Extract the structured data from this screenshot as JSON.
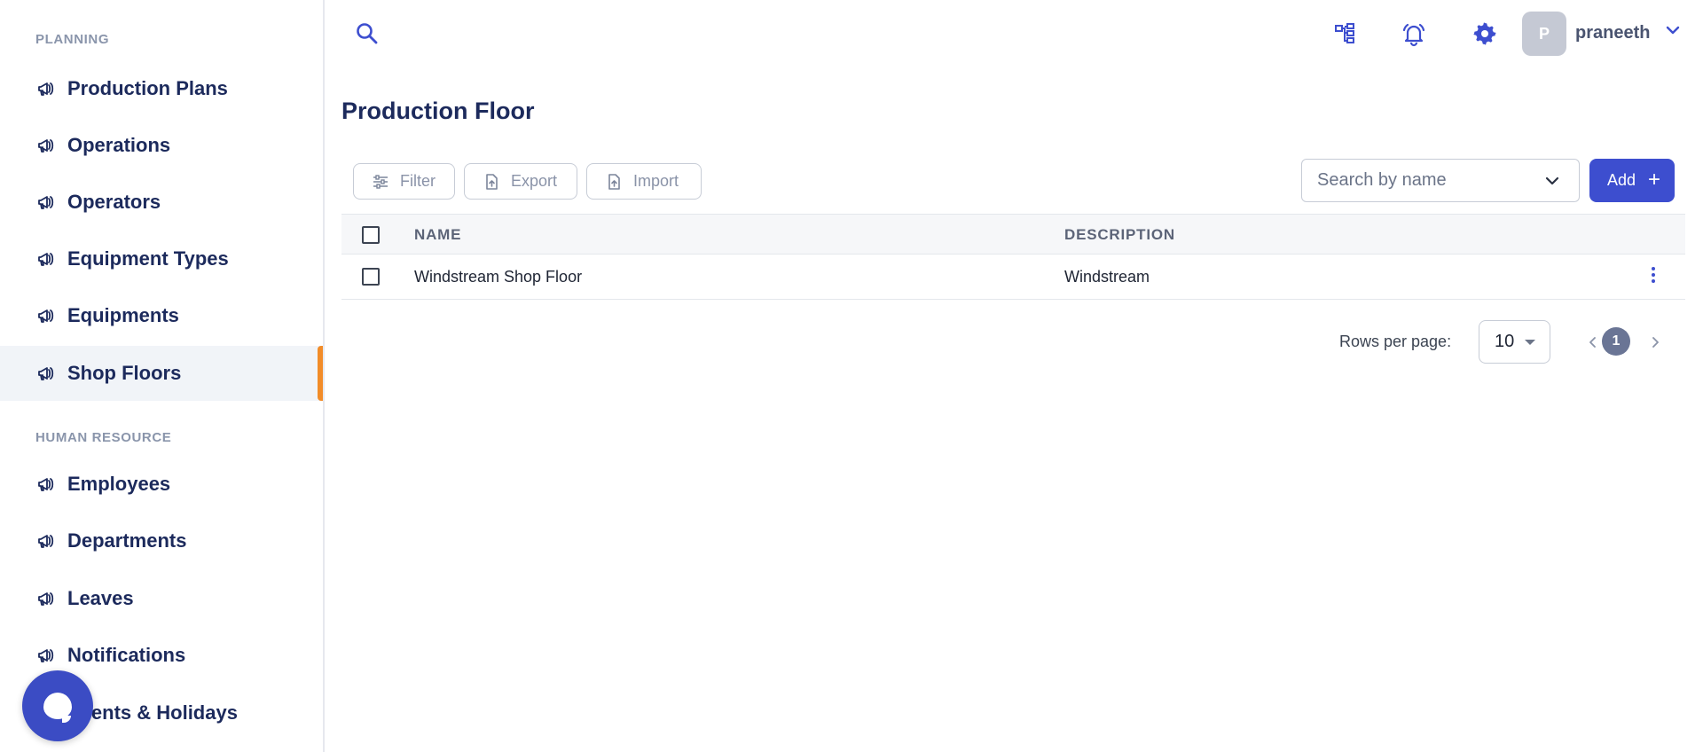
{
  "sidebar": {
    "planning_title": "PLANNING",
    "planning_items": [
      {
        "label": "Production Plans"
      },
      {
        "label": "Operations"
      },
      {
        "label": "Operators"
      },
      {
        "label": "Equipment Types"
      },
      {
        "label": "Equipments"
      },
      {
        "label": "Shop Floors",
        "active": true
      }
    ],
    "hr_title": "HUMAN RESOURCE",
    "hr_items": [
      {
        "label": "Employees"
      },
      {
        "label": "Departments"
      },
      {
        "label": "Leaves"
      },
      {
        "label": "Notifications"
      },
      {
        "label": "Events & Holidays"
      }
    ],
    "nav_icon": "megaphone-icon",
    "active_accent": "#f28c28"
  },
  "topbar": {
    "icons": [
      "search-icon",
      "hierarchy-icon",
      "bell-icon",
      "gear-icon",
      "chevron-down-icon"
    ],
    "avatar_initial": "P",
    "username": "praneeth"
  },
  "page": {
    "title": "Production Floor"
  },
  "toolbar": {
    "filter_label": "Filter",
    "export_label": "Export",
    "import_label": "Import",
    "search_placeholder": "Search by name",
    "add_label": "Add",
    "add_symbol": "+"
  },
  "table": {
    "columns": [
      "NAME",
      "DESCRIPTION"
    ],
    "rows": [
      {
        "name": "Windstream Shop Floor",
        "description": "Windstream"
      }
    ]
  },
  "pagination": {
    "rows_per_page_label": "Rows per page:",
    "rows_per_page_value": "10",
    "current_page": "1"
  },
  "colors": {
    "primary": "#3d4ecf",
    "nav_text": "#1c2a5c",
    "active_bg": "#f1f4f8"
  }
}
